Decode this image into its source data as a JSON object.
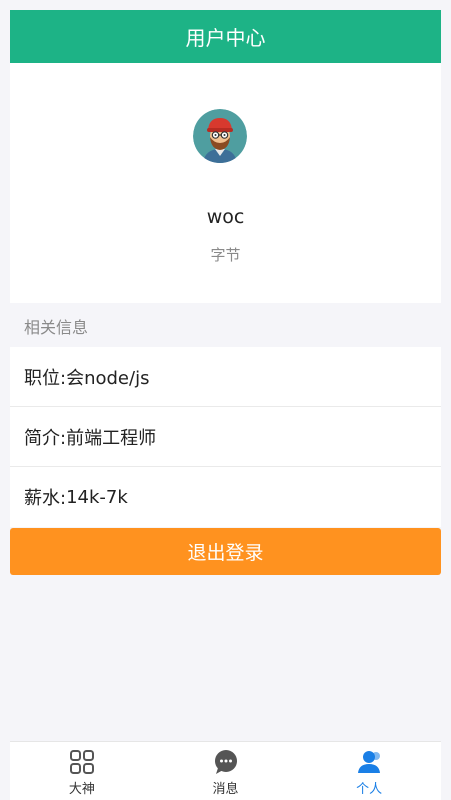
{
  "header": {
    "title": "用户中心"
  },
  "profile": {
    "username": "woc",
    "company": "字节"
  },
  "info": {
    "section_title": "相关信息",
    "rows": [
      {
        "label": "职位:",
        "value": "会node/js"
      },
      {
        "label": "简介:",
        "value": "前端工程师"
      },
      {
        "label": "薪水:",
        "value": "14k-7k"
      }
    ]
  },
  "actions": {
    "logout_label": "退出登录"
  },
  "tabbar": {
    "tabs": [
      {
        "label": "大神",
        "icon": "grid-icon",
        "active": false
      },
      {
        "label": "消息",
        "icon": "chat-bubble-icon",
        "active": false
      },
      {
        "label": "个人",
        "icon": "person-icon",
        "active": true
      }
    ],
    "active_color": "#1a7fe6"
  },
  "colors": {
    "header_bg": "#1db386",
    "logout_bg": "#ff921f"
  }
}
